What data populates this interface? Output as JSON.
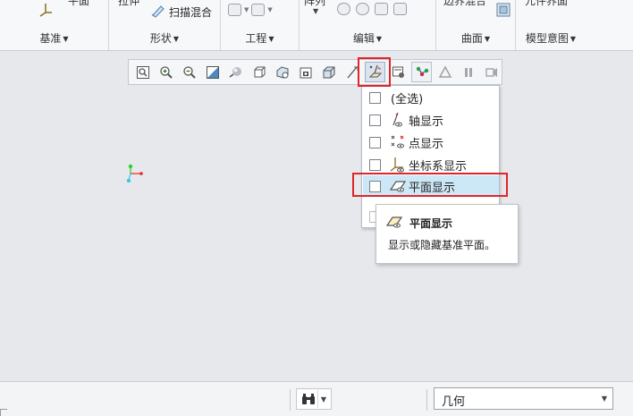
{
  "ribbon": {
    "groups": [
      {
        "label": "基准",
        "cut_text": "平面"
      },
      {
        "label": "形状",
        "cut_text": "拉伸"
      },
      {
        "label": "工程",
        "cut_text": ""
      },
      {
        "label": "编辑",
        "cut_text": "阵列"
      },
      {
        "label": "曲面",
        "cut_text": "边界混合"
      },
      {
        "label": "模型意图",
        "cut_text": "元件界面"
      }
    ],
    "sweep_blend_label": "扫描混合"
  },
  "view_toolbar": {
    "buttons": [
      {
        "name": "refit-icon"
      },
      {
        "name": "zoom-in-icon"
      },
      {
        "name": "zoom-out-icon"
      },
      {
        "name": "repaint-icon"
      },
      {
        "name": "display-style-icon"
      },
      {
        "name": "saved-orientations-icon"
      },
      {
        "name": "view-manager-icon"
      },
      {
        "name": "perspective-view-icon"
      },
      {
        "name": "section-icon"
      },
      {
        "name": "spin-center-icon"
      },
      {
        "name": "datum-display-filters-icon"
      },
      {
        "name": "annotation-display-icon"
      },
      {
        "name": "model-tree-display-icon"
      },
      {
        "name": "simulation-display-icon"
      },
      {
        "name": "pause-icon"
      },
      {
        "name": "animation-icon"
      }
    ]
  },
  "datum_menu": {
    "items": [
      {
        "label": "(全选)",
        "icon": "",
        "checked": false
      },
      {
        "label": "轴显示",
        "icon": "axis-display-icon",
        "checked": false
      },
      {
        "label": "点显示",
        "icon": "point-display-icon",
        "checked": false
      },
      {
        "label": "坐标系显示",
        "icon": "csys-display-icon",
        "checked": false
      },
      {
        "label": "平面显示",
        "icon": "plane-display-icon",
        "checked": false
      }
    ]
  },
  "tooltip": {
    "title": "平面显示",
    "description": "显示或隐藏基准平面。",
    "icon": "plane-display-icon"
  },
  "status_bar": {
    "find_icon": "binoculars-icon",
    "filter_value": "几何"
  },
  "colors": {
    "highlight_box": "#e0252b",
    "menu_hover": "#cce8f6",
    "background": "#e6e8ec"
  }
}
